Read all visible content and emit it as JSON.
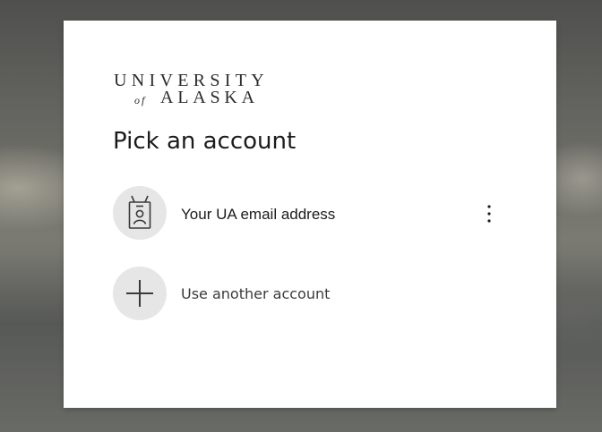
{
  "background": {
    "description_colors": [
      "#5e605b",
      "#7a7a73"
    ]
  },
  "logo": {
    "line1": "UNIVERSITY",
    "of": "of",
    "line2": "ALASKA"
  },
  "heading": "Pick an account",
  "accounts": [
    {
      "label": "Your UA email address",
      "icon": "badge-icon",
      "more_icon": "more-options-icon"
    }
  ],
  "other_option": {
    "label": "Use another account",
    "icon": "plus-icon"
  },
  "colors": {
    "card": "#ffffff",
    "circle": "#e6e6e6",
    "text": "#1b1b1b"
  }
}
